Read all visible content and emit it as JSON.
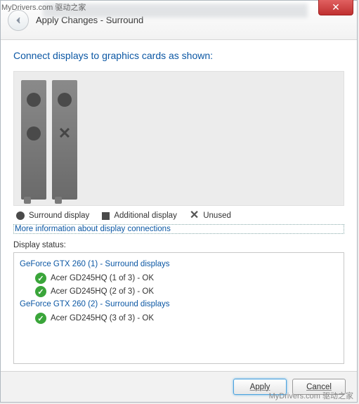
{
  "watermark_tl": "MyDrivers.com 驱动之家",
  "watermark_br": "MyDrivers.com 驱动之家",
  "header": {
    "title": "Apply Changes - Surround"
  },
  "instruction": "Connect displays to graphics cards as shown:",
  "legend": {
    "surround": "Surround display",
    "additional": "Additional display",
    "unused": "Unused"
  },
  "link": "More information about display connections",
  "status_label": "Display status:",
  "gpus": [
    {
      "title": "GeForce GTX 260 (1) - Surround displays",
      "displays": [
        {
          "text": "Acer GD245HQ (1 of 3) - OK"
        },
        {
          "text": "Acer GD245HQ (2 of 3) - OK"
        }
      ]
    },
    {
      "title": "GeForce GTX 260 (2) - Surround displays",
      "displays": [
        {
          "text": "Acer GD245HQ (3 of 3) - OK"
        }
      ]
    }
  ],
  "buttons": {
    "apply": "Apply",
    "cancel": "Cancel"
  }
}
